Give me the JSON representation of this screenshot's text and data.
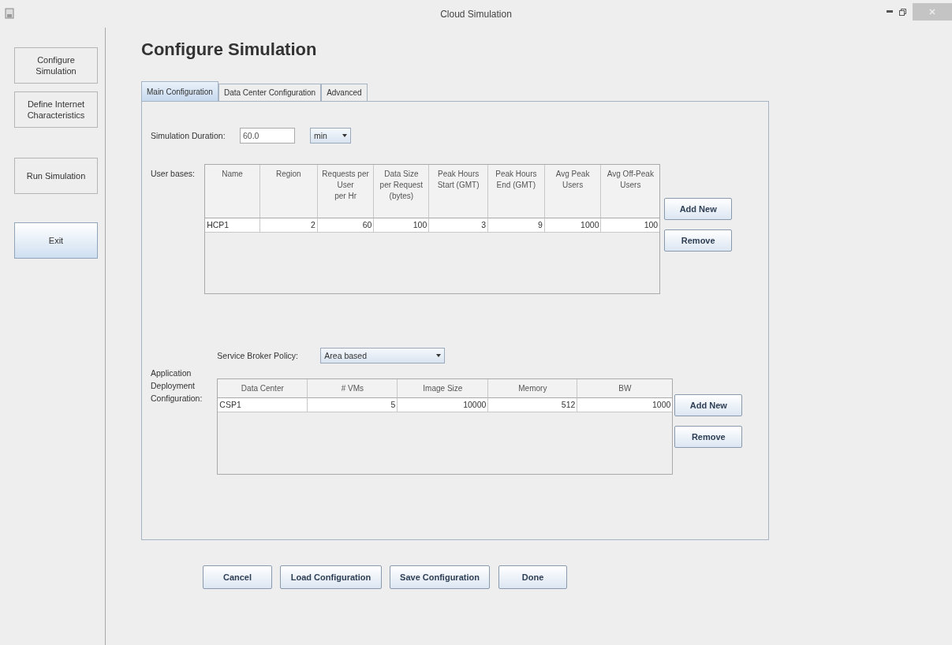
{
  "window": {
    "title": "Cloud Simulation"
  },
  "sidebar": {
    "items": [
      {
        "label": "Configure Simulation",
        "selected": false
      },
      {
        "label": "Define Internet Characteristics",
        "selected": false
      },
      {
        "label": "Run Simulation",
        "selected": false
      },
      {
        "label": "Exit",
        "selected": true
      }
    ]
  },
  "heading": "Configure Simulation",
  "tabs": [
    {
      "label": "Main Configuration",
      "selected": true
    },
    {
      "label": "Data Center Configuration",
      "selected": false
    },
    {
      "label": "Advanced",
      "selected": false
    }
  ],
  "simulation_duration": {
    "label": "Simulation Duration:",
    "value": "60.0",
    "unit": "min"
  },
  "user_bases": {
    "label": "User bases:",
    "columns": [
      "Name",
      "Region",
      "Requests per\nUser\nper Hr",
      "Data Size\nper Request\n(bytes)",
      "Peak Hours\nStart (GMT)",
      "Peak Hours\nEnd (GMT)",
      "Avg Peak\nUsers",
      "Avg Off-Peak\nUsers"
    ],
    "rows": [
      [
        "HCP1",
        "2",
        "60",
        "100",
        "3",
        "9",
        "1000",
        "100"
      ]
    ],
    "buttons": [
      "Add New",
      "Remove"
    ]
  },
  "service_broker_policy": {
    "label": "Service Broker Policy:",
    "value": "Area based"
  },
  "app_deployment": {
    "label": "Application Deployment Configuration:",
    "columns": [
      "Data Center",
      "# VMs",
      "Image Size",
      "Memory",
      "BW"
    ],
    "rows": [
      [
        "CSP1",
        "5",
        "10000",
        "512",
        "1000"
      ]
    ],
    "buttons": [
      "Add New",
      "Remove"
    ]
  },
  "buttons": [
    "Cancel",
    "Load Configuration",
    "Save Configuration",
    "Done"
  ]
}
